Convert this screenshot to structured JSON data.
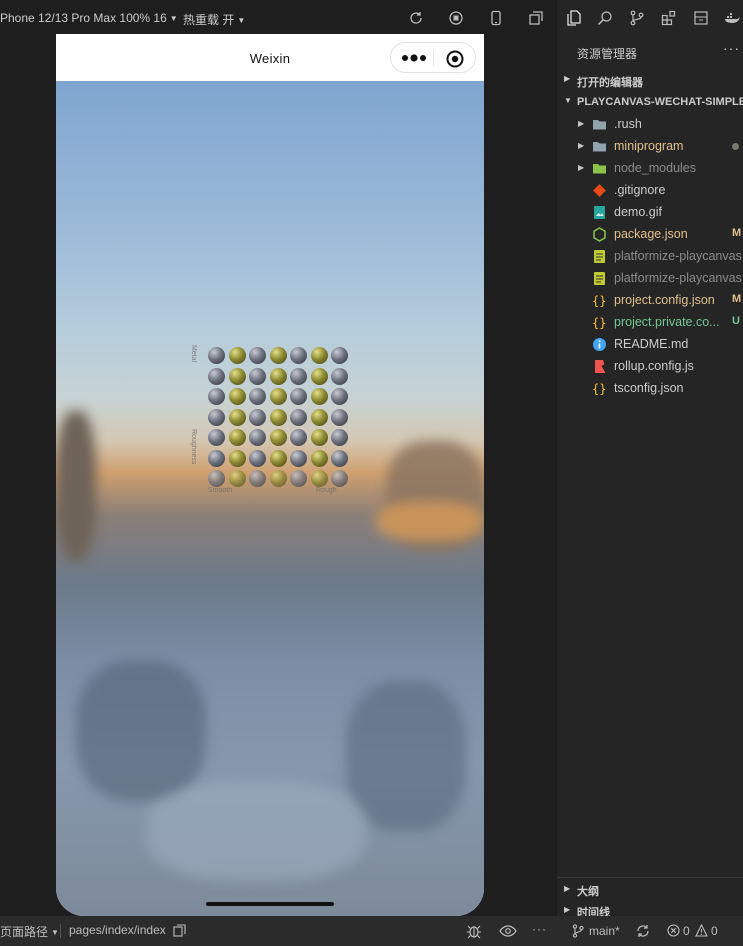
{
  "toolbar": {
    "device": "Phone 12/13 Pro Max 100% 16",
    "hot_reload": "热重载 开"
  },
  "phone": {
    "nav_title": "Weixin",
    "grid_labels": {
      "top_left": "Metal",
      "mid_left": "Roughness",
      "bottom_left": "Smooth",
      "bottom_right": "Rough"
    }
  },
  "statusbar": {
    "path_label": "页面路径",
    "page_path": "pages/index/index",
    "branch": "main*",
    "errors": "0",
    "warnings": "0"
  },
  "explorer": {
    "title": "资源管理器",
    "more": "···",
    "open_editors": "打开的编辑器",
    "project": "PLAYCANVAS-WECHAT-SIMPLE",
    "files": [
      {
        "name": ".rush",
        "type": "folder",
        "badge": "",
        "color": "#cccccc"
      },
      {
        "name": "miniprogram",
        "type": "folder",
        "badge": "dot",
        "color": "#e2c08d"
      },
      {
        "name": "node_modules",
        "type": "folder-node",
        "badge": "",
        "color": "#8c8c8c"
      },
      {
        "name": ".gitignore",
        "type": "git",
        "badge": "",
        "color": "#cccccc"
      },
      {
        "name": "demo.gif",
        "type": "image",
        "badge": "",
        "color": "#cccccc"
      },
      {
        "name": "package.json",
        "type": "node",
        "badge": "M",
        "color": "#e2c08d"
      },
      {
        "name": "platformize-playcanvas",
        "type": "text",
        "badge": "",
        "color": "#8c8c8c"
      },
      {
        "name": "platformize-playcanvas",
        "type": "text",
        "badge": "",
        "color": "#8c8c8c"
      },
      {
        "name": "project.config.json",
        "type": "json",
        "badge": "M",
        "color": "#e2c08d"
      },
      {
        "name": "project.private.co...",
        "type": "json",
        "badge": "U",
        "color": "#73c991"
      },
      {
        "name": "README.md",
        "type": "info",
        "badge": "",
        "color": "#cccccc"
      },
      {
        "name": "rollup.config.js",
        "type": "rollup",
        "badge": "",
        "color": "#cccccc"
      },
      {
        "name": "tsconfig.json",
        "type": "json",
        "badge": "",
        "color": "#cccccc"
      }
    ],
    "outline": "大纲",
    "timeline": "时间线"
  }
}
